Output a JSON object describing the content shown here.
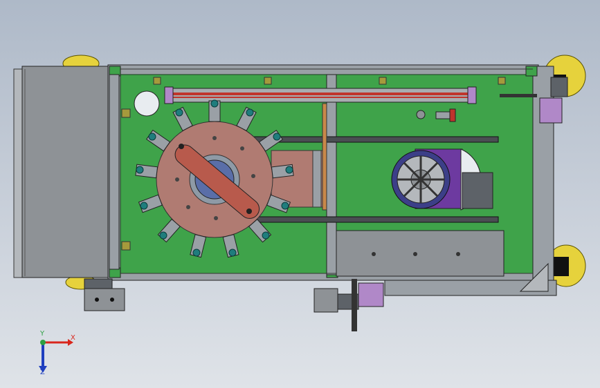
{
  "view": {
    "background_top": "#aeb9c8",
    "background_bottom": "#dfe3e8",
    "model_colors": {
      "base_plate": "#3fa34a",
      "frame_rail": "#9aa0a6",
      "rotary_table": "#b07b72",
      "arm": "#b85a4c",
      "cover_panel": "#8e9296",
      "wheel": "#e6d23c",
      "bracket": "#b088c8",
      "motor_housing": "#6d3aa0",
      "belt": "#c0342c"
    }
  },
  "triad": {
    "x_label": "X",
    "y_label": "Y",
    "z_label": "Z",
    "x_color": "#d9261c",
    "y_color": "#2ea043",
    "z_color": "#1f3fbf"
  }
}
